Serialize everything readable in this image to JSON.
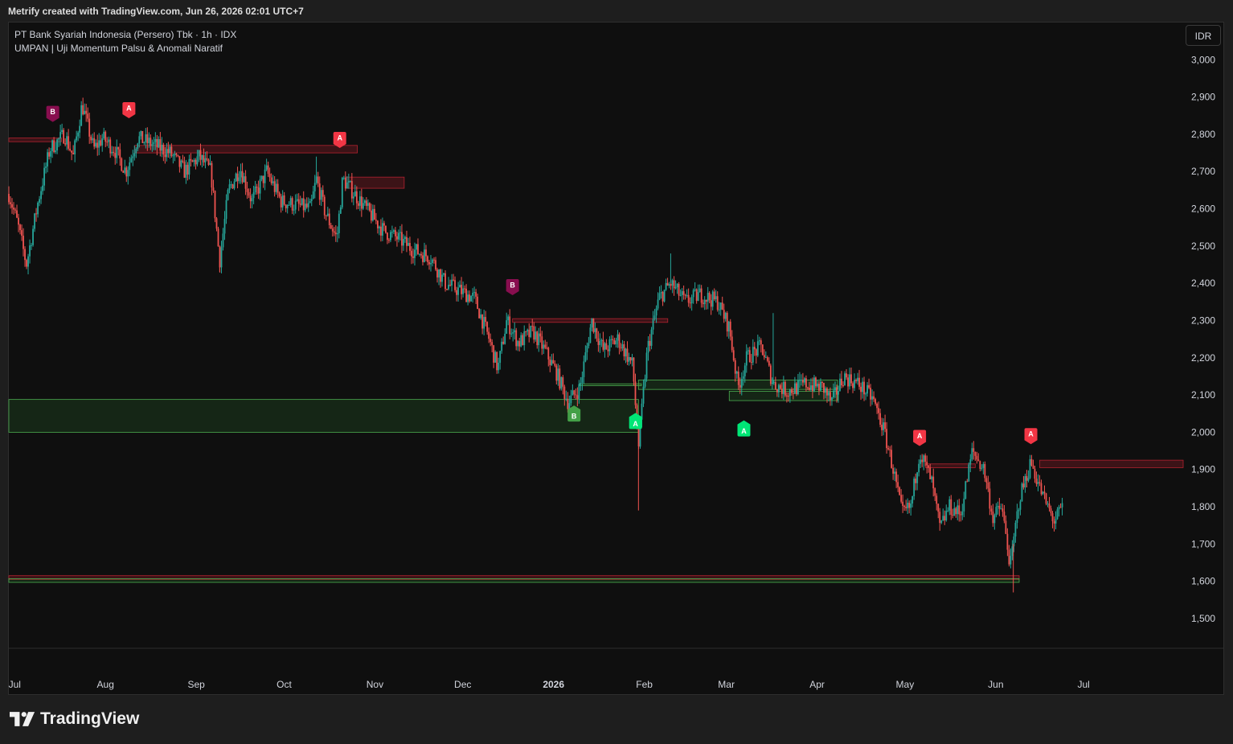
{
  "caption": "Metrify created with TradingView.com, Jun 26, 2026 02:01 UTC+7",
  "legend": {
    "symbol_line": "PT Bank Syariah Indonesia (Persero) Tbk · 1h · IDX",
    "indicator_line": "UMPAN | Uji Momentum Palsu & Anomali Naratif"
  },
  "currency_button": "IDR",
  "brand": "TradingView",
  "colors": {
    "up": "#26a69a",
    "down": "#ef5350",
    "bear_zone": "#b2222f",
    "bull_zone": "#2e7d32",
    "marker_a_red": "#f23645",
    "marker_b_purple": "#880e4f",
    "marker_a_green": "#00e676",
    "marker_b_green": "#43a047"
  },
  "chart_data": {
    "type": "candlestick",
    "title": "PT Bank Syariah Indonesia (Persero) Tbk · 1h · IDX",
    "ylim": [
      1420,
      3100
    ],
    "y_ticks": [
      {
        "label": "3,000",
        "value": 3000
      },
      {
        "label": "2,900",
        "value": 2900
      },
      {
        "label": "2,800",
        "value": 2800
      },
      {
        "label": "2,700",
        "value": 2700
      },
      {
        "label": "2,600",
        "value": 2600
      },
      {
        "label": "2,500",
        "value": 2500
      },
      {
        "label": "2,400",
        "value": 2400
      },
      {
        "label": "2,300",
        "value": 2300
      },
      {
        "label": "2,200",
        "value": 2200
      },
      {
        "label": "2,100",
        "value": 2100
      },
      {
        "label": "2,000",
        "value": 2000
      },
      {
        "label": "1,900",
        "value": 1900
      },
      {
        "label": "1,800",
        "value": 1800
      },
      {
        "label": "1,700",
        "value": 1700
      },
      {
        "label": "1,600",
        "value": 1600
      },
      {
        "label": "1,500",
        "value": 1500
      }
    ],
    "x_range": [
      "2025-06-29",
      "2026-08-04"
    ],
    "x_ticks": [
      {
        "label": "Jul",
        "date": "2025-07-01",
        "bold": false
      },
      {
        "label": "Aug",
        "date": "2025-08-01",
        "bold": false
      },
      {
        "label": "Sep",
        "date": "2025-09-01",
        "bold": false
      },
      {
        "label": "Oct",
        "date": "2025-10-01",
        "bold": false
      },
      {
        "label": "Nov",
        "date": "2025-11-01",
        "bold": false
      },
      {
        "label": "Dec",
        "date": "2025-12-01",
        "bold": false
      },
      {
        "label": "2026",
        "date": "2026-01-01",
        "bold": true
      },
      {
        "label": "Feb",
        "date": "2026-02-01",
        "bold": false
      },
      {
        "label": "Mar",
        "date": "2026-03-01",
        "bold": false
      },
      {
        "label": "Apr",
        "date": "2026-04-01",
        "bold": false
      },
      {
        "label": "May",
        "date": "2026-05-01",
        "bold": false
      },
      {
        "label": "Jun",
        "date": "2026-06-01",
        "bold": false
      },
      {
        "label": "Jul",
        "date": "2026-07-01",
        "bold": false
      }
    ],
    "price_path": [
      [
        "2025-06-29",
        2640
      ],
      [
        "2025-07-02",
        2560
      ],
      [
        "2025-07-05",
        2450
      ],
      [
        "2025-07-09",
        2620
      ],
      [
        "2025-07-13",
        2760
      ],
      [
        "2025-07-18",
        2800
      ],
      [
        "2025-07-21",
        2740
      ],
      [
        "2025-07-24",
        2880
      ],
      [
        "2025-07-28",
        2760
      ],
      [
        "2025-07-31",
        2790
      ],
      [
        "2025-08-04",
        2760
      ],
      [
        "2025-08-08",
        2700
      ],
      [
        "2025-08-12",
        2790
      ],
      [
        "2025-08-18",
        2770
      ],
      [
        "2025-08-23",
        2750
      ],
      [
        "2025-08-28",
        2700
      ],
      [
        "2025-09-02",
        2740
      ],
      [
        "2025-09-06",
        2700
      ],
      [
        "2025-09-09",
        2460
      ],
      [
        "2025-09-12",
        2650
      ],
      [
        "2025-09-16",
        2710
      ],
      [
        "2025-09-20",
        2620
      ],
      [
        "2025-09-25",
        2700
      ],
      [
        "2025-09-30",
        2620
      ],
      [
        "2025-10-05",
        2610
      ],
      [
        "2025-10-10",
        2600
      ],
      [
        "2025-10-12",
        2680
      ],
      [
        "2025-10-15",
        2590
      ],
      [
        "2025-10-19",
        2520
      ],
      [
        "2025-10-21",
        2680
      ],
      [
        "2025-10-25",
        2640
      ],
      [
        "2025-10-29",
        2600
      ],
      [
        "2025-11-04",
        2540
      ],
      [
        "2025-11-09",
        2520
      ],
      [
        "2025-11-14",
        2490
      ],
      [
        "2025-11-20",
        2470
      ],
      [
        "2025-11-25",
        2400
      ],
      [
        "2025-11-30",
        2380
      ],
      [
        "2025-12-05",
        2360
      ],
      [
        "2025-12-10",
        2250
      ],
      [
        "2025-12-13",
        2170
      ],
      [
        "2025-12-16",
        2300
      ],
      [
        "2025-12-20",
        2240
      ],
      [
        "2025-12-25",
        2270
      ],
      [
        "2025-12-29",
        2220
      ],
      [
        "2026-01-02",
        2160
      ],
      [
        "2026-01-06",
        2080
      ],
      [
        "2026-01-10",
        2120
      ],
      [
        "2026-01-14",
        2300
      ],
      [
        "2026-01-18",
        2220
      ],
      [
        "2026-01-23",
        2250
      ],
      [
        "2026-01-28",
        2180
      ],
      [
        "2026-01-30",
        1960
      ],
      [
        "2026-02-02",
        2220
      ],
      [
        "2026-02-06",
        2360
      ],
      [
        "2026-02-10",
        2400
      ],
      [
        "2026-02-15",
        2350
      ],
      [
        "2026-02-20",
        2370
      ],
      [
        "2026-02-26",
        2350
      ],
      [
        "2026-03-02",
        2280
      ],
      [
        "2026-03-05",
        2120
      ],
      [
        "2026-03-08",
        2200
      ],
      [
        "2026-03-13",
        2230
      ],
      [
        "2026-03-17",
        2130
      ],
      [
        "2026-03-22",
        2110
      ],
      [
        "2026-03-28",
        2130
      ],
      [
        "2026-04-03",
        2120
      ],
      [
        "2026-04-06",
        2080
      ],
      [
        "2026-04-10",
        2150
      ],
      [
        "2026-04-15",
        2130
      ],
      [
        "2026-04-20",
        2090
      ],
      [
        "2026-04-24",
        2000
      ],
      [
        "2026-04-27",
        1900
      ],
      [
        "2026-04-30",
        1780
      ],
      [
        "2026-05-03",
        1800
      ],
      [
        "2026-05-06",
        1950
      ],
      [
        "2026-05-10",
        1870
      ],
      [
        "2026-05-13",
        1740
      ],
      [
        "2026-05-16",
        1800
      ],
      [
        "2026-05-20",
        1780
      ],
      [
        "2026-05-24",
        1950
      ],
      [
        "2026-05-28",
        1900
      ],
      [
        "2026-05-31",
        1770
      ],
      [
        "2026-06-03",
        1800
      ],
      [
        "2026-06-06",
        1640
      ],
      [
        "2026-06-09",
        1820
      ],
      [
        "2026-06-13",
        1920
      ],
      [
        "2026-06-17",
        1830
      ],
      [
        "2026-06-21",
        1760
      ],
      [
        "2026-06-24",
        1800
      ]
    ],
    "spikes": [
      {
        "date": "2025-09-09",
        "low": 2430
      },
      {
        "date": "2026-01-30",
        "low": 1790
      },
      {
        "date": "2026-06-07",
        "low": 1570
      },
      {
        "date": "2026-02-10",
        "high": 2480
      },
      {
        "date": "2026-03-17",
        "high": 2320
      },
      {
        "date": "2025-10-12",
        "high": 2740
      }
    ],
    "zones": [
      {
        "kind": "bear",
        "start": "2025-06-29",
        "end": "2025-07-17",
        "top": 2790,
        "bottom": 2780
      },
      {
        "kind": "bear",
        "start": "2025-08-11",
        "end": "2025-10-26",
        "top": 2770,
        "bottom": 2750
      },
      {
        "kind": "bear",
        "start": "2025-10-22",
        "end": "2025-11-11",
        "top": 2685,
        "bottom": 2655
      },
      {
        "kind": "bear",
        "start": "2025-12-18",
        "end": "2026-02-09",
        "top": 2305,
        "bottom": 2295
      },
      {
        "kind": "bull",
        "start": "2025-06-29",
        "end": "2026-01-30",
        "top": 2088,
        "bottom": 2000
      },
      {
        "kind": "bull",
        "start": "2026-01-30",
        "end": "2026-04-08",
        "top": 2140,
        "bottom": 2115
      },
      {
        "kind": "bull",
        "start": "2026-03-02",
        "end": "2026-04-08",
        "top": 2110,
        "bottom": 2085
      },
      {
        "kind": "bull",
        "start": "2026-01-10",
        "end": "2026-01-31",
        "top": 2130,
        "bottom": 2125
      },
      {
        "kind": "bear",
        "start": "2026-05-08",
        "end": "2026-05-25",
        "top": 1915,
        "bottom": 1905
      },
      {
        "kind": "bear",
        "start": "2026-06-16",
        "end": "2026-08-04",
        "top": 1925,
        "bottom": 1905
      },
      {
        "kind": "bear",
        "start": "2025-06-29",
        "end": "2026-06-09",
        "top": 1615,
        "bottom": 1605
      },
      {
        "kind": "bull",
        "start": "2025-06-29",
        "end": "2026-06-09",
        "top": 1607,
        "bottom": 1597
      }
    ],
    "signals": [
      {
        "label": "B",
        "kind": "b_purple",
        "date": "2025-07-14",
        "price": 2860,
        "dir": "down"
      },
      {
        "label": "A",
        "kind": "a_red",
        "date": "2025-08-09",
        "price": 2870,
        "dir": "down"
      },
      {
        "label": "A",
        "kind": "a_red",
        "date": "2025-10-20",
        "price": 2790,
        "dir": "down"
      },
      {
        "label": "B",
        "kind": "b_purple",
        "date": "2025-12-18",
        "price": 2395,
        "dir": "down"
      },
      {
        "label": "B",
        "kind": "b_green",
        "date": "2026-01-08",
        "price": 2045,
        "dir": "up"
      },
      {
        "label": "A",
        "kind": "a_green",
        "date": "2026-01-29",
        "price": 2025,
        "dir": "up"
      },
      {
        "label": "A",
        "kind": "a_green",
        "date": "2026-03-07",
        "price": 2005,
        "dir": "up"
      },
      {
        "label": "A",
        "kind": "a_red",
        "date": "2026-05-06",
        "price": 1990,
        "dir": "down"
      },
      {
        "label": "A",
        "kind": "a_red",
        "date": "2026-06-13",
        "price": 1995,
        "dir": "down"
      }
    ]
  }
}
